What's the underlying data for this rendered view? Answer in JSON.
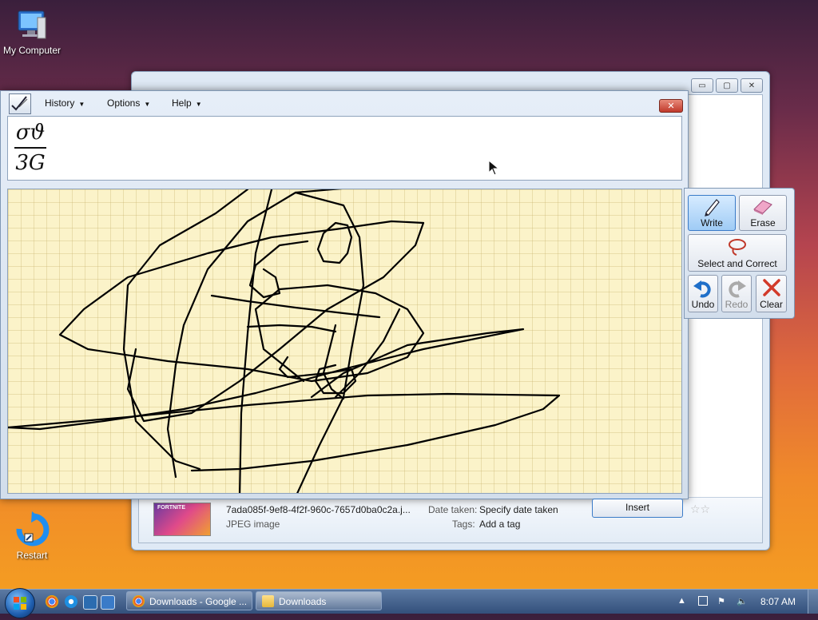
{
  "desktop": {
    "icons": [
      {
        "label": "My Computer"
      },
      {
        "label": "Restart"
      }
    ]
  },
  "explorer": {
    "buttons": {
      "minimize": "▭",
      "maximize": "▢",
      "close": "✕"
    },
    "details": {
      "thumbnail_text": "FORTNITE",
      "filename": "7ada085f-9ef8-4f2f-960c-7657d0ba0c2a.j...",
      "filetype": "JPEG image",
      "date_label": "Date taken:",
      "date_value": "Specify date taken",
      "tags_label": "Tags:",
      "tags_value": "Add a tag",
      "stars": "☆☆"
    }
  },
  "math_panel": {
    "menu": {
      "history": "History",
      "options": "Options",
      "help": "Help"
    },
    "close_label": "✕",
    "preview": {
      "numerator": "σϑ",
      "denominator": "3G"
    },
    "tools": {
      "write": "Write",
      "erase": "Erase",
      "select_correct": "Select and Correct",
      "undo": "Undo",
      "redo": "Redo",
      "clear": "Clear"
    },
    "insert_label": "Insert"
  },
  "taskbar": {
    "tasks": [
      {
        "label": "Downloads - Google ..."
      },
      {
        "label": "Downloads"
      }
    ],
    "clock": "8:07 AM"
  },
  "colors": {
    "ink": "#000000",
    "canvas": "#fbf3c9",
    "accent": "#3a7bc8"
  }
}
